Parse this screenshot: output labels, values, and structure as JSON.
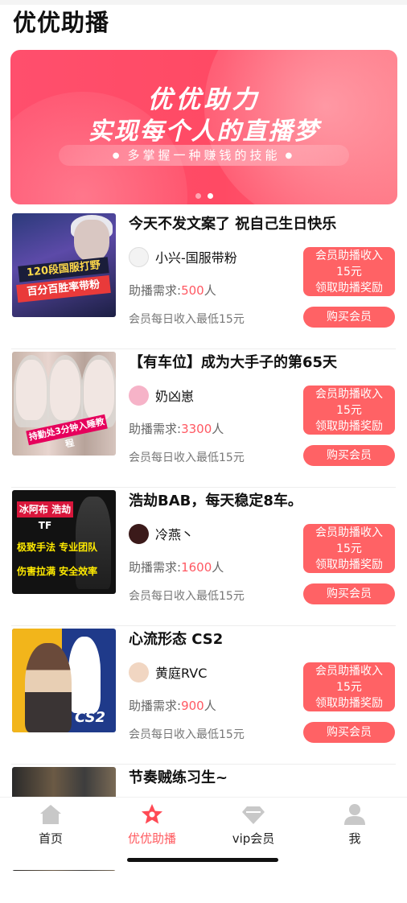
{
  "app": {
    "title": "优优助播"
  },
  "banner": {
    "line1": "优优助力",
    "line2": "实现每个人的直播梦",
    "slogan": "多掌握一种赚钱的技能",
    "dots": 2,
    "active_dot": 2
  },
  "colors": {
    "accent": "#ff6265",
    "number": "#ff5862",
    "nav_active": "#ff5a5f"
  },
  "listings": [
    {
      "title": "今天不发文案了 祝自己生日快乐",
      "streamer": "小兴-国服带粉",
      "need_label": "助播需求:",
      "need_value": "500",
      "need_unit": "人",
      "daily": "会员每日收入最低15元",
      "reward_line1": "会员助播收入",
      "reward_line2": "15元",
      "reward_line3": "领取助播奖励",
      "buy": "购买会员",
      "thumb_text": [
        "120段国服打野",
        "百分百胜率带粉"
      ]
    },
    {
      "title": "【有车位】成为大手子的第65天",
      "streamer": "奶凶崽",
      "need_label": "助播需求:",
      "need_value": "3300",
      "need_unit": "人",
      "daily": "会员每日收入最低15元",
      "reward_line1": "会员助播收入",
      "reward_line2": "15元",
      "reward_line3": "领取助播奖励",
      "buy": "购买会员",
      "thumb_text": [
        "持勤处3分钟入睡教程"
      ]
    },
    {
      "title": "浩劫BAB，每天稳定8车。",
      "streamer": "冷燕丶",
      "need_label": "助播需求:",
      "need_value": "1600",
      "need_unit": "人",
      "daily": "会员每日收入最低15元",
      "reward_line1": "会员助播收入",
      "reward_line2": "15元",
      "reward_line3": "领取助播奖励",
      "buy": "购买会员",
      "thumb_text": [
        "冰阿布 浩劫 TF",
        "极致手法 专业团队",
        "伤害拉满 安全效率"
      ]
    },
    {
      "title": "心流形态 CS2",
      "streamer": "黄庭RVC",
      "need_label": "助播需求:",
      "need_value": "900",
      "need_unit": "人",
      "daily": "会员每日收入最低15元",
      "reward_line1": "会员助播收入",
      "reward_line2": "15元",
      "reward_line3": "领取助播奖励",
      "buy": "购买会员",
      "thumb_text": [
        "CS2"
      ]
    },
    {
      "title": "节奏贼练习生~"
    }
  ],
  "nav": [
    {
      "label": "首页",
      "icon": "home-icon"
    },
    {
      "label": "优优助播",
      "icon": "star-icon"
    },
    {
      "label": "vip会员",
      "icon": "diamond-icon"
    },
    {
      "label": "我",
      "icon": "person-icon"
    }
  ],
  "nav_active_index": 1
}
